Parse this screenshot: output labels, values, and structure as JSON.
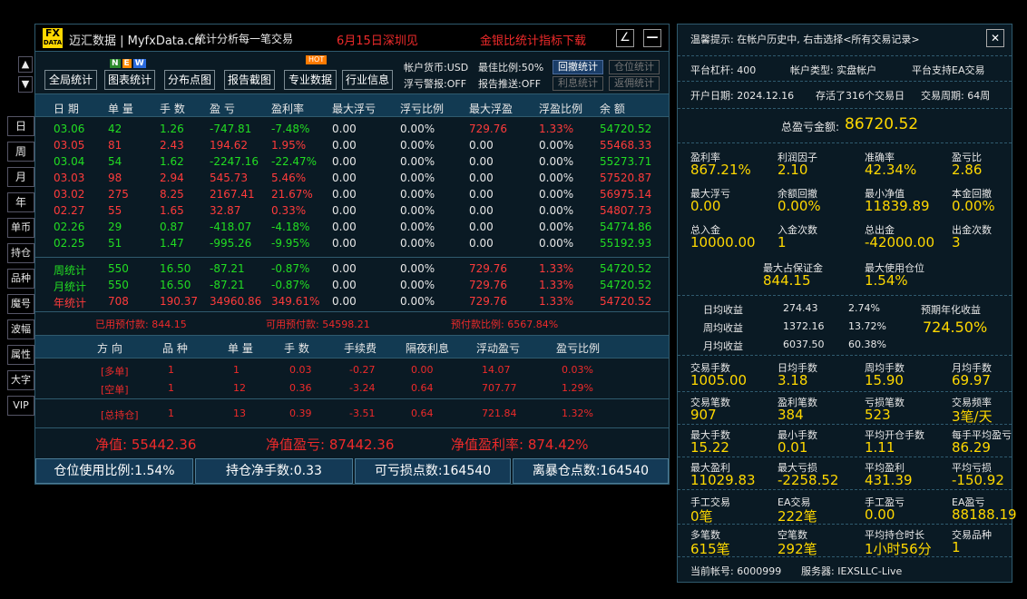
{
  "arrows": {
    "up": "▲",
    "down": "▼"
  },
  "leftnav": [
    "日",
    "周",
    "月",
    "年",
    "单币",
    "持仓",
    "品种",
    "魔号",
    "波幅",
    "属性",
    "大字",
    "VIP"
  ],
  "header": {
    "logo_top": "FX",
    "logo_bottom": "DATA",
    "brand": "迈汇数据 | MyfxData.cn",
    "slogan": "统计分析每一笔交易",
    "event": "6月15日深圳见",
    "download": "金银比统计指标下载",
    "pencil": "∠",
    "minimize": "—"
  },
  "toolbar": {
    "global": "全局统计",
    "chart": "图表统计",
    "scatter": "分布点图",
    "report": "报告截图",
    "pro": "专业数据",
    "industry": "行业信息",
    "new_n": "N",
    "new_e": "E",
    "new_w": "W",
    "hot": "HOT"
  },
  "account_info": {
    "currency": "帐户货币:USD",
    "margin_ratio": "最佳比例:50%",
    "float_alert": "浮亏警报:OFF",
    "report_push": "报告推送:OFF",
    "btn_drawdown": "回撤统计",
    "btn_position": "仓位统计",
    "btn_interest": "利息统计",
    "btn_commission": "返佣统计"
  },
  "columns": [
    "日 期",
    "单 量",
    "手 数",
    "盈 亏",
    "盈利率",
    "最大浮亏",
    "浮亏比例",
    "最大浮盈",
    "浮盈比例",
    "余 额"
  ],
  "daily": [
    {
      "c": "grn",
      "v": [
        "03.06",
        "42",
        "1.26",
        "-747.81",
        "-7.48%",
        "0.00",
        "0.00%",
        "729.76",
        "1.33%",
        "54720.52"
      ]
    },
    {
      "c": "red",
      "v": [
        "03.05",
        "81",
        "2.43",
        "194.62",
        "1.95%",
        "0.00",
        "0.00%",
        "0.00",
        "0.00%",
        "55468.33"
      ]
    },
    {
      "c": "grn",
      "v": [
        "03.04",
        "54",
        "1.62",
        "-2247.16",
        "-22.47%",
        "0.00",
        "0.00%",
        "0.00",
        "0.00%",
        "55273.71"
      ]
    },
    {
      "c": "red",
      "v": [
        "03.03",
        "98",
        "2.94",
        "545.73",
        "5.46%",
        "0.00",
        "0.00%",
        "0.00",
        "0.00%",
        "57520.87"
      ]
    },
    {
      "c": "red",
      "v": [
        "03.02",
        "275",
        "8.25",
        "2167.41",
        "21.67%",
        "0.00",
        "0.00%",
        "0.00",
        "0.00%",
        "56975.14"
      ]
    },
    {
      "c": "red",
      "v": [
        "02.27",
        "55",
        "1.65",
        "32.87",
        "0.33%",
        "0.00",
        "0.00%",
        "0.00",
        "0.00%",
        "54807.73"
      ]
    },
    {
      "c": "grn",
      "v": [
        "02.26",
        "29",
        "0.87",
        "-418.07",
        "-4.18%",
        "0.00",
        "0.00%",
        "0.00",
        "0.00%",
        "54774.86"
      ]
    },
    {
      "c": "grn",
      "v": [
        "02.25",
        "51",
        "1.47",
        "-995.26",
        "-9.95%",
        "0.00",
        "0.00%",
        "0.00",
        "0.00%",
        "55192.93"
      ]
    }
  ],
  "summary": [
    {
      "c": "grn",
      "v": [
        "周统计",
        "550",
        "16.50",
        "-87.21",
        "-0.87%",
        "0.00",
        "0.00%",
        "729.76",
        "1.33%",
        "54720.52"
      ]
    },
    {
      "c": "grn",
      "v": [
        "月统计",
        "550",
        "16.50",
        "-87.21",
        "-0.87%",
        "0.00",
        "0.00%",
        "729.76",
        "1.33%",
        "54720.52"
      ]
    },
    {
      "c": "red",
      "v": [
        "年统计",
        "708",
        "190.37",
        "34960.86",
        "349.61%",
        "0.00",
        "0.00%",
        "729.76",
        "1.33%",
        "54720.52"
      ]
    }
  ],
  "margin": {
    "used": "已用预付款: 844.15",
    "available": "可用预付款: 54598.21",
    "ratio": "预付款比例: 6567.84%"
  },
  "pos_columns": [
    "方 向",
    "品 种",
    "单 量",
    "手 数",
    "手续费",
    "隔夜利息",
    "浮动盈亏",
    "盈亏比例"
  ],
  "positions": [
    {
      "c": "dred",
      "v": [
        "[多单]",
        "1",
        "1",
        "0.03",
        "-0.27",
        "0.00",
        "14.07",
        "0.03%"
      ]
    },
    {
      "c": "dred",
      "v": [
        "[空单]",
        "1",
        "12",
        "0.36",
        "-3.24",
        "0.64",
        "707.77",
        "1.29%"
      ]
    },
    {
      "c": "dred",
      "v": [
        "[总持仓]",
        "1",
        "13",
        "0.39",
        "-3.51",
        "0.64",
        "721.84",
        "1.32%"
      ]
    }
  ],
  "net": {
    "value": "净值: 55442.36",
    "pnl": "净值盈亏: 87442.36",
    "rate": "净值盈利率: 874.42%"
  },
  "bottom": {
    "usage": "仓位使用比例:1.54%",
    "net_lots": "持仓净手数:0.33",
    "stop_points": "可亏损点数:164540",
    "liq_points": "离暴仓点数:164540"
  },
  "right": {
    "tip": "温馨提示: 在帐户历史中, 右击选择<所有交易记录>",
    "close": "✕",
    "leverage": "平台杠杆: 400",
    "acct_type": "帐户类型: 实盘帐户",
    "ea": "平台支持EA交易",
    "open_date": "开户日期: 2024.12.16",
    "days": "存活了316个交易日",
    "period": "交易周期: 64周",
    "total_label": "总盈亏金额:",
    "total_value": "86720.52",
    "g1": [
      [
        "盈利率",
        "867.21%"
      ],
      [
        "利润因子",
        "2.10"
      ],
      [
        "准确率",
        "42.34%"
      ],
      [
        "盈亏比",
        "2.86"
      ]
    ],
    "g2": [
      [
        "最大浮亏",
        "0.00"
      ],
      [
        "余额回撤",
        "0.00%"
      ],
      [
        "最小净值",
        "11839.89"
      ],
      [
        "本金回撤",
        "0.00%"
      ]
    ],
    "g3": [
      [
        "总入金",
        "10000.00"
      ],
      [
        "入金次数",
        "1"
      ],
      [
        "总出金",
        "-42000.00"
      ],
      [
        "出金次数",
        "3"
      ]
    ],
    "g4": [
      [
        "最大占保证金",
        "844.15"
      ],
      [
        "最大使用仓位",
        "1.54%"
      ]
    ],
    "returns": [
      [
        "日均收益",
        "274.43",
        "2.74%"
      ],
      [
        "周均收益",
        "1372.16",
        "13.72%"
      ],
      [
        "月均收益",
        "6037.50",
        "60.38%"
      ]
    ],
    "annual_label": "预期年化收益",
    "annual_value": "724.50%",
    "s1": [
      [
        "交易手数",
        "1005.00"
      ],
      [
        "日均手数",
        "3.18"
      ],
      [
        "周均手数",
        "15.90"
      ],
      [
        "月均手数",
        "69.97"
      ]
    ],
    "s2": [
      [
        "交易笔数",
        "907"
      ],
      [
        "盈利笔数",
        "384"
      ],
      [
        "亏损笔数",
        "523"
      ],
      [
        "交易频率",
        "3笔/天"
      ]
    ],
    "s3": [
      [
        "最大手数",
        "15.22"
      ],
      [
        "最小手数",
        "0.01"
      ],
      [
        "平均开仓手数",
        "1.11"
      ],
      [
        "每手平均盈亏",
        "86.29"
      ]
    ],
    "s4": [
      [
        "最大盈利",
        "11029.83"
      ],
      [
        "最大亏损",
        "-2258.52"
      ],
      [
        "平均盈利",
        "431.39"
      ],
      [
        "平均亏损",
        "-150.92"
      ]
    ],
    "s5": [
      [
        "手工交易",
        "0笔"
      ],
      [
        "EA交易",
        "222笔"
      ],
      [
        "手工盈亏",
        "0.00"
      ],
      [
        "EA盈亏",
        "88188.19"
      ]
    ],
    "s6": [
      [
        "多笔数",
        "615笔"
      ],
      [
        "空笔数",
        "292笔"
      ],
      [
        "平均持仓时长",
        "1小时56分"
      ],
      [
        "交易品种",
        "1"
      ]
    ],
    "account": "当前帐号: 6000999",
    "server": "服务器: IEXSLLC-Live"
  }
}
